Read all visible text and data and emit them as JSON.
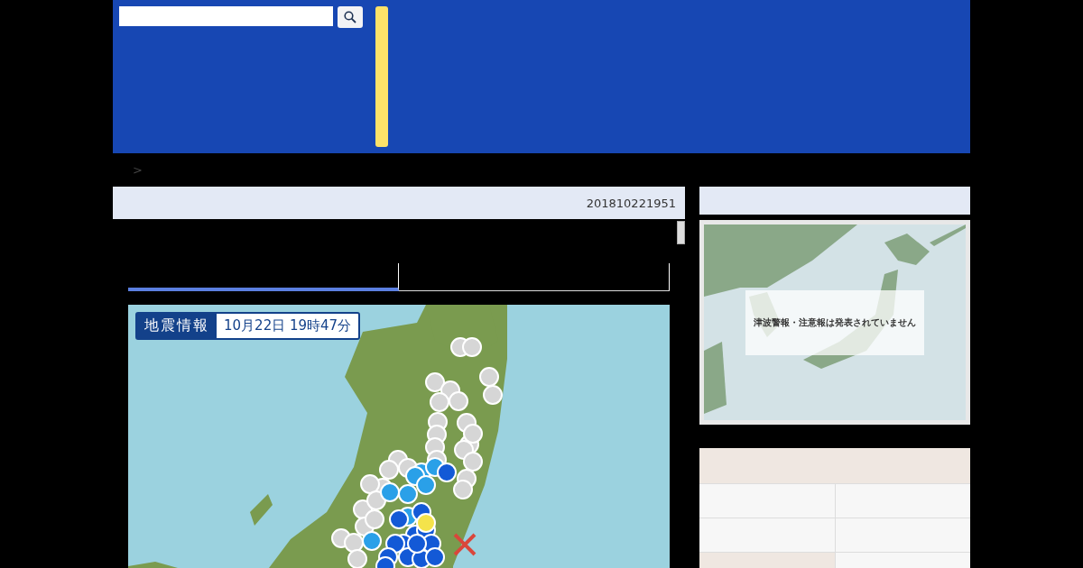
{
  "breadcrumb": {
    "separator": ">"
  },
  "report_bar": {
    "id": "201810221951"
  },
  "tabs": [
    {
      "selected": true
    },
    {
      "selected": false
    }
  ],
  "quake_map": {
    "kind": "picture",
    "title": "地震情報",
    "time": "10月22日 19時47分"
  },
  "tsunami_map": {
    "kind": "picture",
    "message": "津波警報・注意報は発表されていません"
  },
  "info_table": {
    "rows": [
      {
        "kind": "plain"
      },
      {
        "kind": "plain"
      },
      {
        "kind": "header"
      }
    ]
  }
}
